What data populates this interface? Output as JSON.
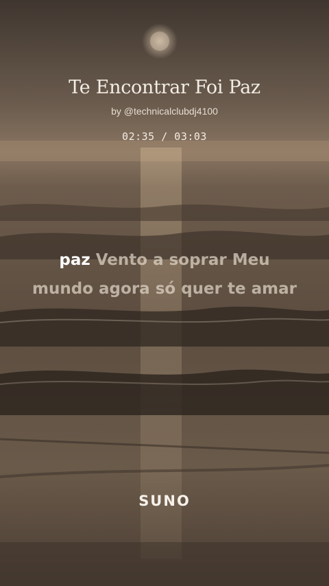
{
  "song": {
    "title": "Te Encontrar Foi Paz",
    "byline": "by @technicalclubdj4100",
    "time": "02:35 / 03:03"
  },
  "lyrics": {
    "active_word": "paz",
    "line1_rest": "Vento a soprar Meu",
    "line2": "mundo agora só quer te amar"
  },
  "brand": {
    "logo": "SUNO"
  },
  "colors": {
    "sky": "#6b5a49",
    "sea": "#4e4237",
    "sun_glow": "#e8c79a",
    "text_active": "#ffffff",
    "text_upcoming": "#e1d7c8"
  }
}
